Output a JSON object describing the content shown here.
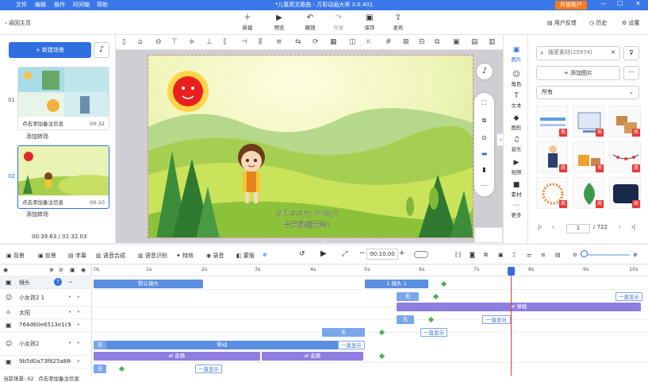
{
  "menubar": {
    "items": [
      "文件",
      "编辑",
      "操作",
      "时间轴",
      "帮助"
    ],
    "title": "*儿童英文歌曲 - 万彩动画大师 3.0.401",
    "upgrade": "升级账户",
    "window_controls": [
      "—",
      "☐",
      "✕"
    ]
  },
  "toolbar": {
    "back_home": "返回主页",
    "buttons": [
      {
        "label": "新建",
        "icon": "plus-icon",
        "glyph": "＋"
      },
      {
        "label": "预览",
        "icon": "preview-icon",
        "glyph": "▶"
      },
      {
        "label": "撤销",
        "icon": "undo-icon",
        "glyph": "↶"
      },
      {
        "label": "恢复",
        "icon": "redo-icon",
        "glyph": "↷"
      },
      {
        "label": "保存",
        "icon": "save-icon",
        "glyph": "▣"
      },
      {
        "label": "发布",
        "icon": "publish-icon",
        "glyph": "⇪"
      }
    ],
    "feedback": "用户反馈",
    "history": "历史",
    "settings": "设置"
  },
  "left_panel": {
    "new_scene": "+ 新建场景",
    "scenes": [
      {
        "number": "01",
        "note": "点击添加备注信息",
        "duration": "00:32",
        "selected": false
      },
      {
        "number": "02",
        "note": "点击添加备注信息",
        "duration": "00:10",
        "selected": true
      }
    ],
    "add_transition": "添加转场",
    "time_current": "00:39.63",
    "time_total": "/ 01:32.03"
  },
  "stage": {
    "subtitle_en": "Is it sunny today?",
    "subtitle_cn": "今天是晴天吗?",
    "corner_label": "1"
  },
  "right_nav": {
    "items": [
      {
        "label": "图片",
        "icon": "image-icon",
        "glyph": "▣",
        "selected": true
      },
      {
        "label": "角色",
        "icon": "character-icon",
        "glyph": "☺",
        "selected": false
      },
      {
        "label": "文本",
        "icon": "text-icon",
        "glyph": "T",
        "selected": false
      },
      {
        "label": "图形",
        "icon": "shape-icon",
        "glyph": "◆",
        "selected": false
      },
      {
        "label": "音乐",
        "icon": "music-icon",
        "glyph": "♫",
        "selected": false
      },
      {
        "label": "视频",
        "icon": "video-icon",
        "glyph": "▶",
        "selected": false
      },
      {
        "label": "素材",
        "icon": "folder-icon",
        "glyph": "■",
        "selected": false
      },
      {
        "label": "更多",
        "icon": "more-icon",
        "glyph": "⋯",
        "selected": false
      }
    ]
  },
  "asset_panel": {
    "search_placeholder": "搜更素材(25974)",
    "add_image": "+ 添加图片",
    "filter": "所有",
    "badge": "商",
    "page_current": "1",
    "page_total": "/ 722"
  },
  "timeline_toolbar": {
    "items": [
      "背景",
      "前景",
      "字幕",
      "语音合成",
      "语音识别",
      "特效",
      "录音",
      "蒙版"
    ],
    "time_value": "00:10.00"
  },
  "timeline": {
    "ticks": [
      "0s",
      "1s",
      "2s",
      "3s",
      "4s",
      "5s",
      "6s",
      "7s",
      "8s",
      "9s",
      "10s"
    ],
    "playhead_time": "7.5s",
    "layers": [
      {
        "name": "镜头",
        "icon": "camera-icon",
        "glyph": "▣"
      },
      {
        "name": "小女孩2 1",
        "icon": "character-icon",
        "glyph": "☺"
      },
      {
        "name": "太阳",
        "icon": "sun-icon",
        "glyph": "☼"
      },
      {
        "name": "764d60e6513e1c5",
        "icon": "image-icon",
        "glyph": "▣"
      },
      {
        "name": "小女孩2",
        "icon": "character-icon",
        "glyph": "☺"
      },
      {
        "name": "9b5d0a73f825a86",
        "icon": "image-icon",
        "glyph": "▣"
      }
    ],
    "bars": {
      "default_camera": "默认镜头",
      "camera1": "1 镜头 1",
      "none": "无",
      "always_show": "一直显示",
      "move": "移动",
      "jump": "⇄ 弹跳",
      "walk": "⇄ 走路"
    }
  },
  "status": {
    "text": "当前场景: 02",
    "note": "点击添加备注信息"
  },
  "colors": {
    "brand": "#3a78e8",
    "accent": "#2f6fe0",
    "upgrade": "#ff7a1a",
    "playhead": "#e53935"
  }
}
